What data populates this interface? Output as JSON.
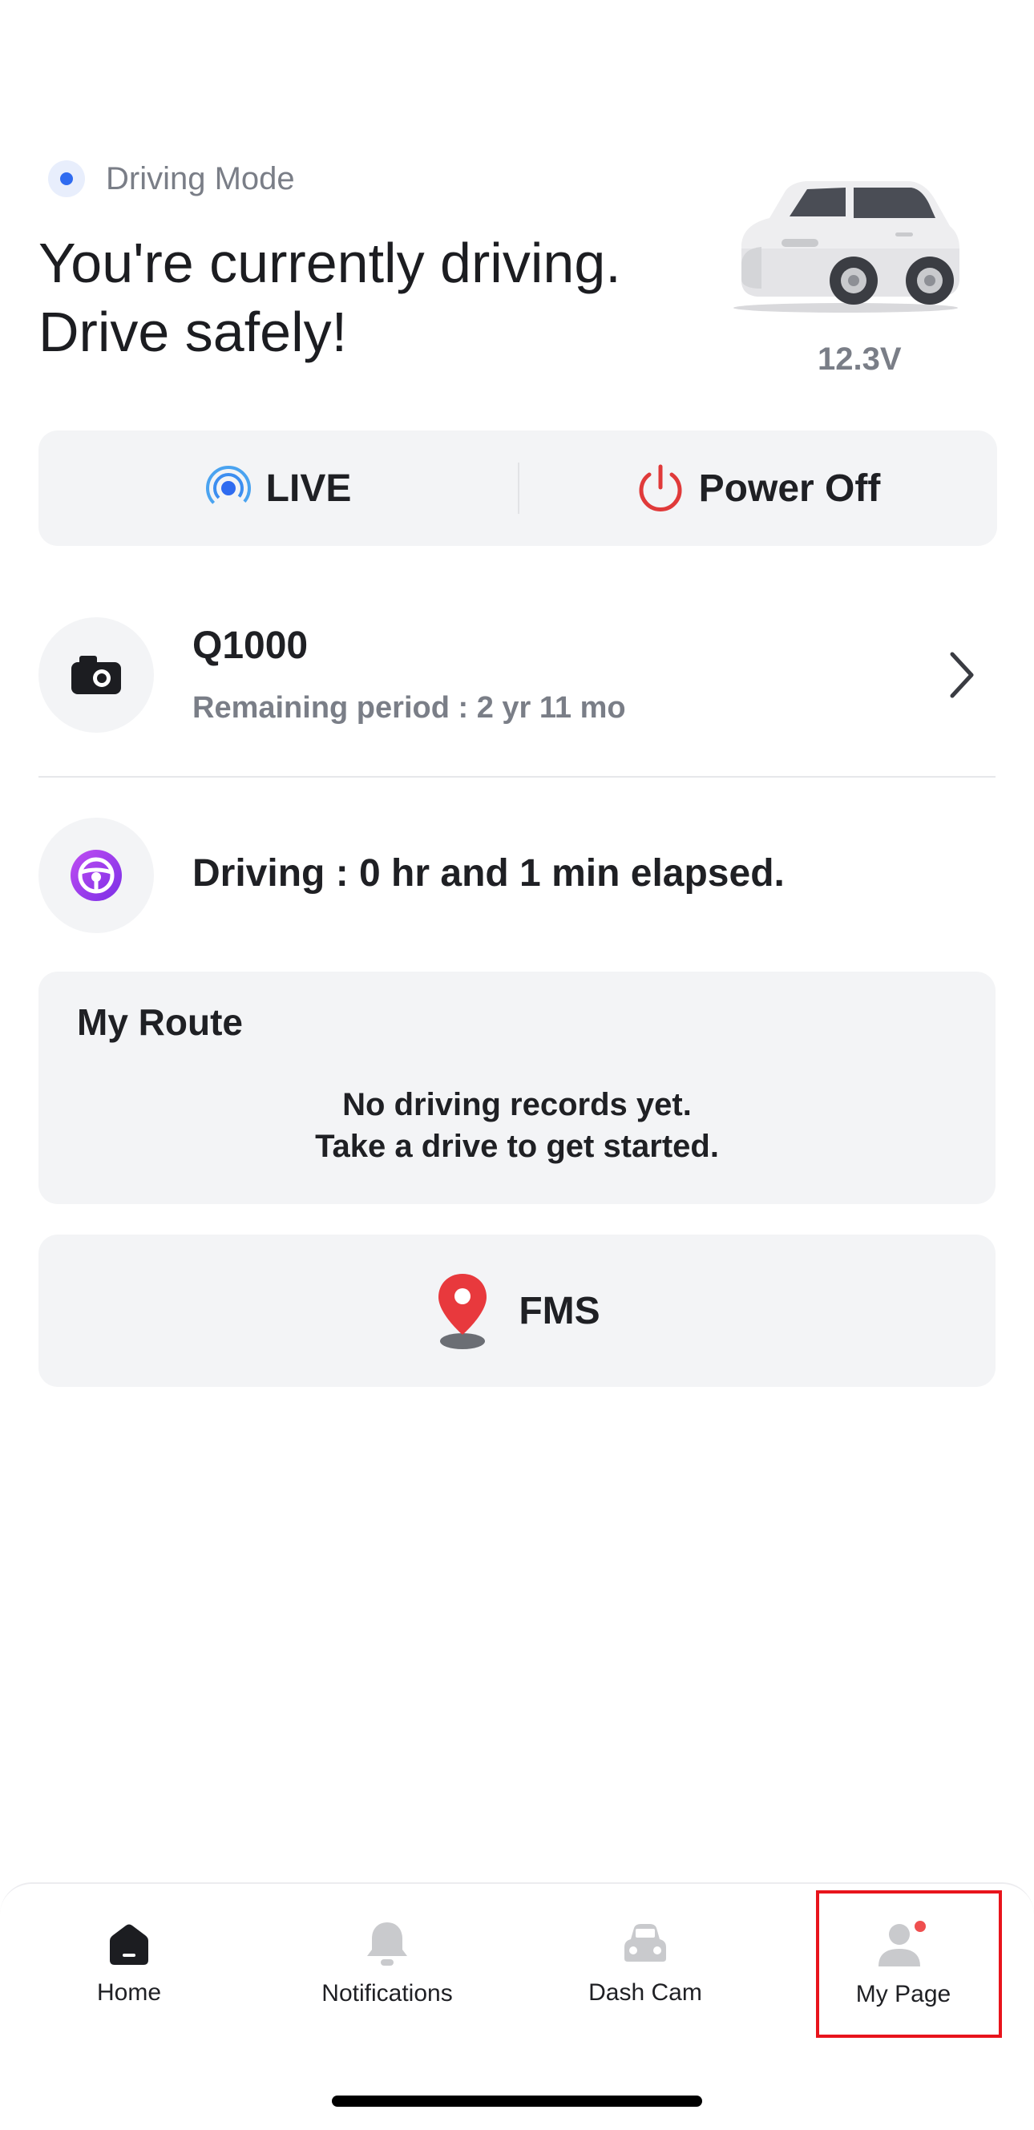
{
  "header": {
    "mode_label": "Driving Mode",
    "headline_line1": "You're currently driving.",
    "headline_line2": "Drive safely!",
    "voltage": "12.3V"
  },
  "actions": {
    "live_label": "LIVE",
    "power_label": "Power Off"
  },
  "device": {
    "name": "Q1000",
    "remaining": "Remaining period : 2 yr 11 mo"
  },
  "driving": {
    "status": "Driving : 0 hr and 1 min elapsed."
  },
  "route": {
    "title": "My Route",
    "empty_line1": "No driving records yet.",
    "empty_line2": "Take a drive to get started."
  },
  "fms": {
    "label": "FMS"
  },
  "nav": {
    "items": [
      {
        "label": "Home",
        "icon": "home-icon"
      },
      {
        "label": "Notifications",
        "icon": "bell-icon"
      },
      {
        "label": "Dash Cam",
        "icon": "car-icon"
      },
      {
        "label": "My Page",
        "icon": "person-icon"
      }
    ]
  },
  "colors": {
    "accent_blue": "#2f6bf0",
    "power_red": "#e03a3a",
    "driving_purple": "#9b3df0",
    "badge_red": "#ef4f4f"
  }
}
